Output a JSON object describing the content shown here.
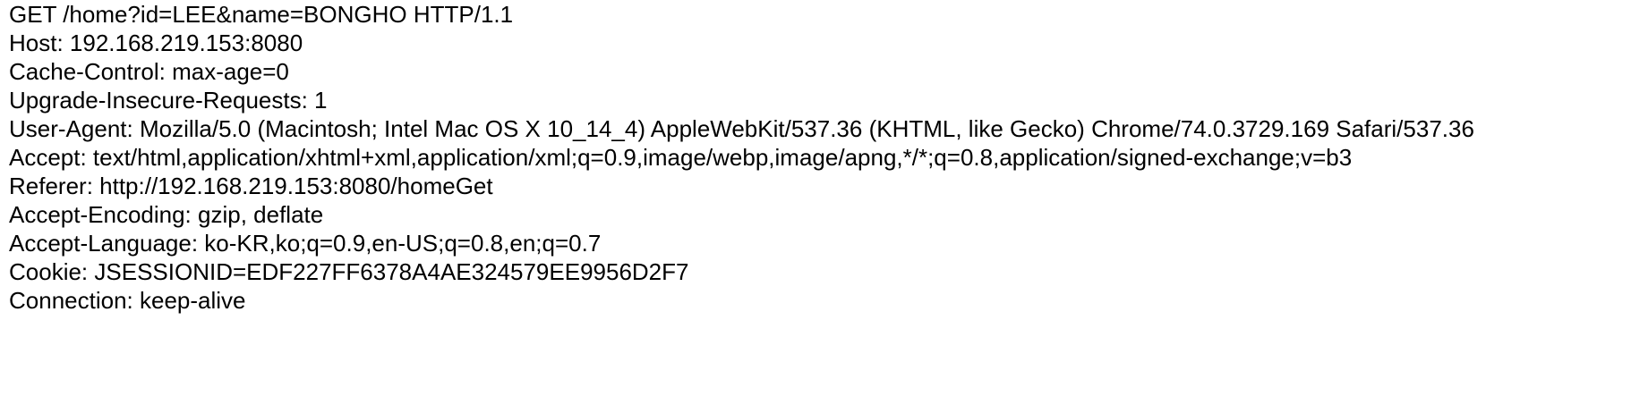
{
  "request": {
    "request_line": "GET /home?id=LEE&name=BONGHO HTTP/1.1",
    "headers": [
      "Host: 192.168.219.153:8080",
      "Cache-Control: max-age=0",
      "Upgrade-Insecure-Requests: 1",
      "User-Agent: Mozilla/5.0 (Macintosh; Intel Mac OS X 10_14_4) AppleWebKit/537.36 (KHTML, like Gecko) Chrome/74.0.3729.169 Safari/537.36",
      "Accept: text/html,application/xhtml+xml,application/xml;q=0.9,image/webp,image/apng,*/*;q=0.8,application/signed-exchange;v=b3",
      "Referer: http://192.168.219.153:8080/homeGet",
      "Accept-Encoding: gzip, deflate",
      "Accept-Language: ko-KR,ko;q=0.9,en-US;q=0.8,en;q=0.7",
      "Cookie: JSESSIONID=EDF227FF6378A4AE324579EE9956D2F7",
      "Connection: keep-alive"
    ]
  }
}
